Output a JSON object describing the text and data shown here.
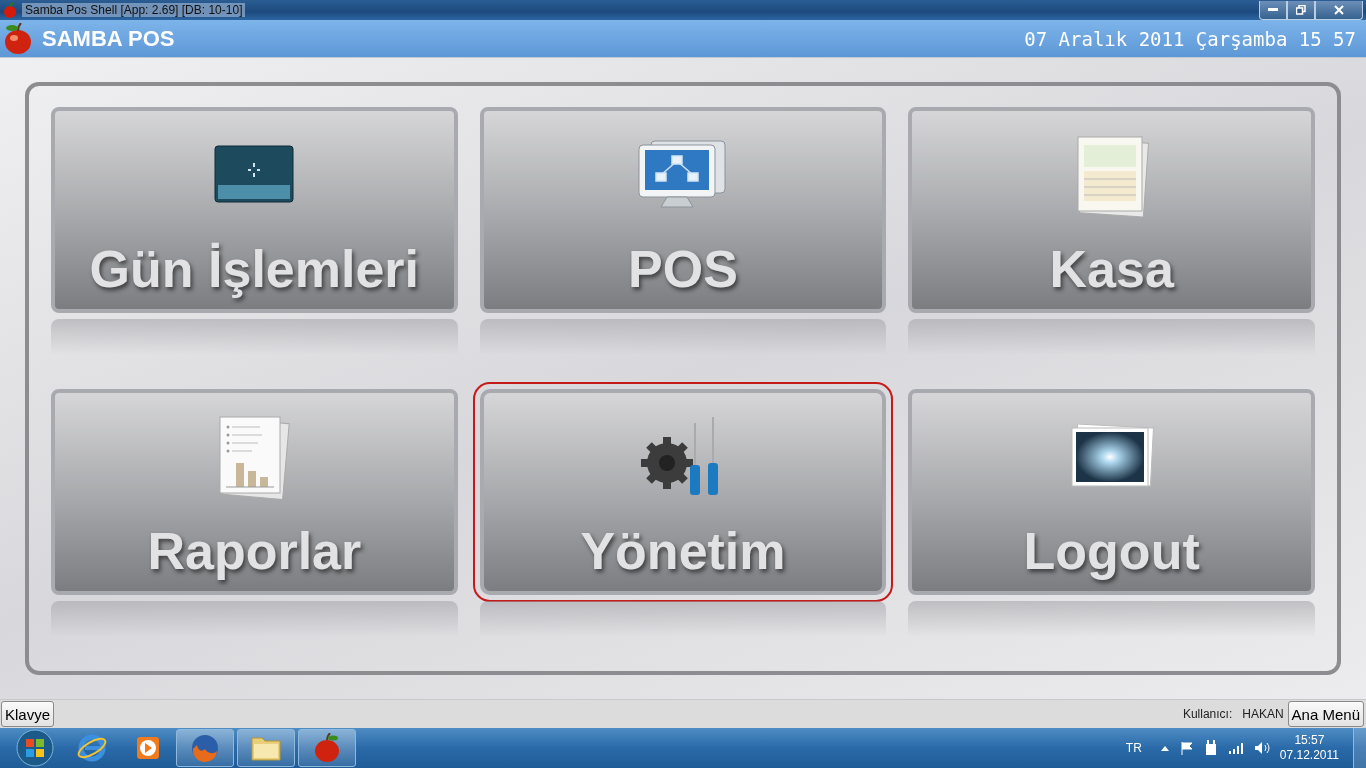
{
  "window": {
    "title": "Samba Pos Shell [App: 2.69] [DB: 10-10]"
  },
  "header": {
    "app_name": "SAMBA POS",
    "datetime": "07 Aralık 2011 Çarşamba 15 57"
  },
  "tiles": [
    {
      "label": "Gün İşlemleri",
      "kind": "display",
      "selected": false
    },
    {
      "label": "POS",
      "kind": "monitor",
      "selected": false
    },
    {
      "label": "Kasa",
      "kind": "documents",
      "selected": false
    },
    {
      "label": "Raporlar",
      "kind": "report",
      "selected": false
    },
    {
      "label": "Yönetim",
      "kind": "tools",
      "selected": true
    },
    {
      "label": "Logout",
      "kind": "photo",
      "selected": false
    }
  ],
  "bottom_bar": {
    "keyboard_button": "Klavye",
    "user_label": "Kullanıcı:",
    "user_name": "HAKAN",
    "main_menu_button": "Ana Menü"
  },
  "taskbar": {
    "language": "TR",
    "time": "15:57",
    "date": "07.12.2011"
  }
}
